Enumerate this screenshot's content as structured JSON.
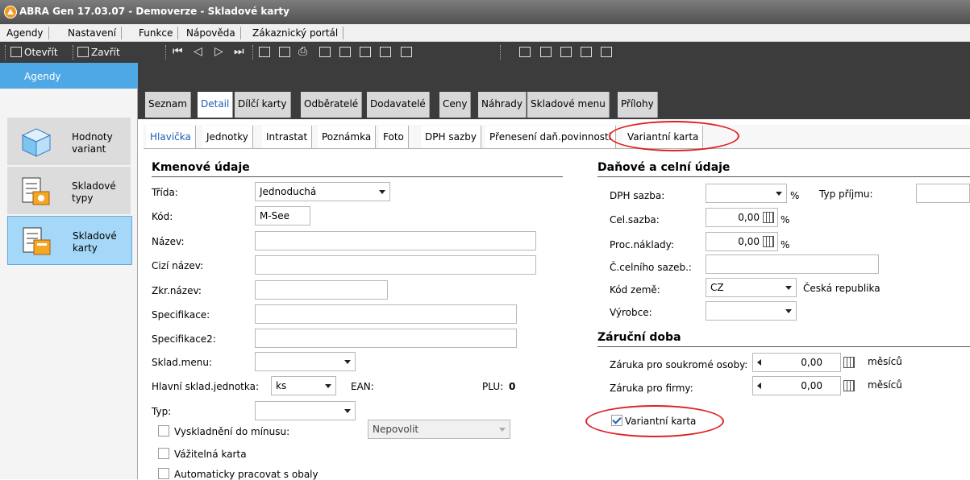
{
  "window": {
    "title": "ABRA Gen 17.03.07 - Demoverze - Skladové karty"
  },
  "menu": [
    "Agendy",
    "Nastavení",
    "Funkce",
    "Nápověda",
    "Zákaznický portál"
  ],
  "toolbar": {
    "open_label": "Otevřít",
    "close_label": "Zavřít"
  },
  "sidebar": {
    "header": "Agendy",
    "items": [
      {
        "label": "Hodnoty variant"
      },
      {
        "label": "Skladové typy"
      },
      {
        "label": "Skladové karty"
      }
    ]
  },
  "tabs": [
    "Seznam",
    "Detail",
    "Dílčí karty",
    "Odběratelé",
    "Dodavatelé",
    "Ceny",
    "Náhrady",
    "Skladové menu",
    "Přílohy"
  ],
  "subtabs": [
    "Hlavička",
    "Jednotky",
    "Intrastat",
    "Poznámka",
    "Foto",
    "DPH sazby",
    "Přenesení daň.povinnosti",
    "Variantní karta"
  ],
  "left": {
    "section_title": "Kmenové údaje",
    "trida_label": "Třída:",
    "trida_value": "Jednoduchá",
    "kod_label": "Kód:",
    "kod_value": "M-See",
    "nazev_label": "Název:",
    "cizi_nazev_label": "Cizí název:",
    "zkr_nazev_label": "Zkr.název:",
    "specifikace_label": "Specifikace:",
    "specifikace2_label": "Specifikace2:",
    "sklad_menu_label": "Sklad.menu:",
    "hlavni_jednotka_label": "Hlavní sklad.jednotka:",
    "hlavni_jednotka_value": "ks",
    "ean_label": "EAN:",
    "plu_label": "PLU:",
    "plu_value": "0",
    "typ_label": "Typ:",
    "vyskladneni_label": "Vyskladnění do mínusu:",
    "vyskladneni_value": "Nepovolit",
    "vazitelna_label": "Vážitelná karta",
    "obaly_label": "Automaticky pracovat s obaly"
  },
  "right": {
    "section_title": "Daňové a celní údaje",
    "dph_label": "DPH sazba:",
    "dph_unit": "%",
    "typ_prijmu_label": "Typ příjmu:",
    "cel_sazba_label": "Cel.sazba:",
    "cel_sazba_value": "0,00",
    "cel_unit": "%",
    "proc_naklady_label": "Proc.náklady:",
    "proc_naklady_value": "0,00",
    "proc_unit": "%",
    "celni_sazeb_label": "Č.celního sazeb.:",
    "kod_zeme_label": "Kód země:",
    "kod_zeme_value": "CZ",
    "zeme_name": "Česká republika",
    "vyrobce_label": "Výrobce:",
    "zarucni_title": "Záruční doba",
    "zaruka_osoby_label": "Záruka pro soukromé osoby:",
    "zaruka_osoby_value": "0,00",
    "zaruka_osoby_unit": "měsíců",
    "zaruka_firmy_label": "Záruka pro firmy:",
    "zaruka_firmy_value": "0,00",
    "zaruka_firmy_unit": "měsíců",
    "variantni_label": "Variantní karta"
  },
  "colors": {
    "accent": "#4fa8e6",
    "highlight_ellipse": "#e02020",
    "title_bar": "#5a5a5a"
  }
}
